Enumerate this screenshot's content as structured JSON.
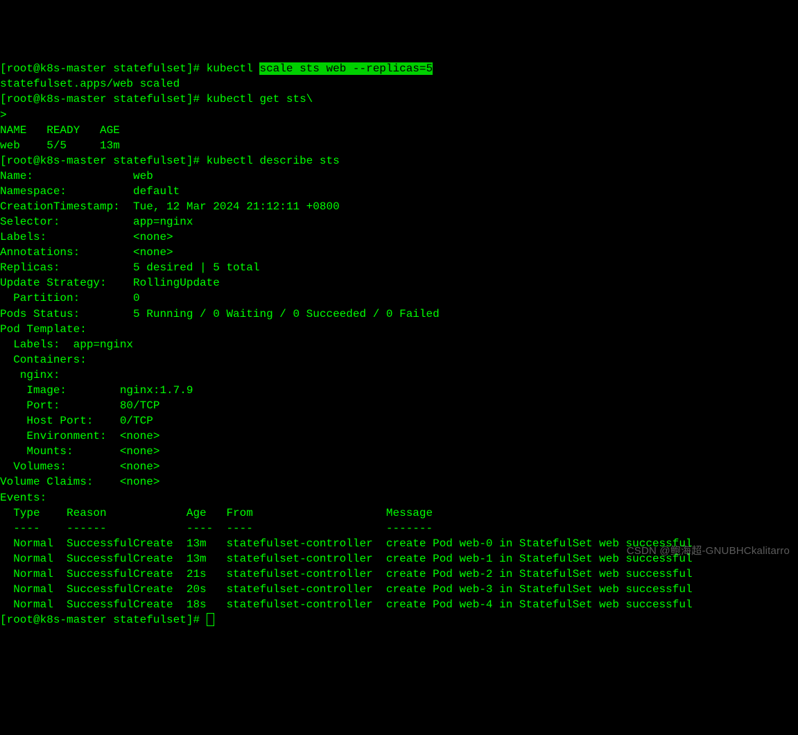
{
  "prompt": "[root@k8s-master statefulset]# ",
  "cmd1_pre": "kubectl ",
  "cmd1_hl": "scale sts web --replicas=5",
  "cmd1_out": "statefulset.apps/web scaled",
  "cmd2": "kubectl get sts\\",
  "cont_prompt": "> ",
  "get_header": "NAME   READY   AGE",
  "get_row": "web    5/5     13m",
  "cmd3": "kubectl describe sts",
  "desc": {
    "name": "Name:               web",
    "ns": "Namespace:          default",
    "ts": "CreationTimestamp:  Tue, 12 Mar 2024 21:12:11 +0800",
    "sel": "Selector:           app=nginx",
    "labels": "Labels:             <none>",
    "ann": "Annotations:        <none>",
    "rep": "Replicas:           5 desired | 5 total",
    "upd": "Update Strategy:    RollingUpdate",
    "part": "  Partition:        0",
    "pods": "Pods Status:        5 Running / 0 Waiting / 0 Succeeded / 0 Failed",
    "pt": "Pod Template:",
    "pt_lab": "  Labels:  app=nginx",
    "pt_con": "  Containers:",
    "pt_ng": "   nginx:",
    "pt_img": "    Image:        nginx:1.7.9",
    "pt_port": "    Port:         80/TCP",
    "pt_hport": "    Host Port:    0/TCP",
    "pt_env": "    Environment:  <none>",
    "pt_mnt": "    Mounts:       <none>",
    "pt_vol": "  Volumes:        <none>",
    "vc": "Volume Claims:    <none>",
    "ev": "Events:",
    "ev_hd": "  Type    Reason            Age   From                    Message",
    "ev_sep": "  ----    ------            ----  ----                    -------",
    "ev0": "  Normal  SuccessfulCreate  13m   statefulset-controller  create Pod web-0 in StatefulSet web successful",
    "ev1": "  Normal  SuccessfulCreate  13m   statefulset-controller  create Pod web-1 in StatefulSet web successful",
    "ev2": "  Normal  SuccessfulCreate  21s   statefulset-controller  create Pod web-2 in StatefulSet web successful",
    "ev3": "  Normal  SuccessfulCreate  20s   statefulset-controller  create Pod web-3 in StatefulSet web successful",
    "ev4": "  Normal  SuccessfulCreate  18s   statefulset-controller  create Pod web-4 in StatefulSet web successful"
  },
  "watermark": "CSDN @鲍海超-GNUBHCkalitarro"
}
